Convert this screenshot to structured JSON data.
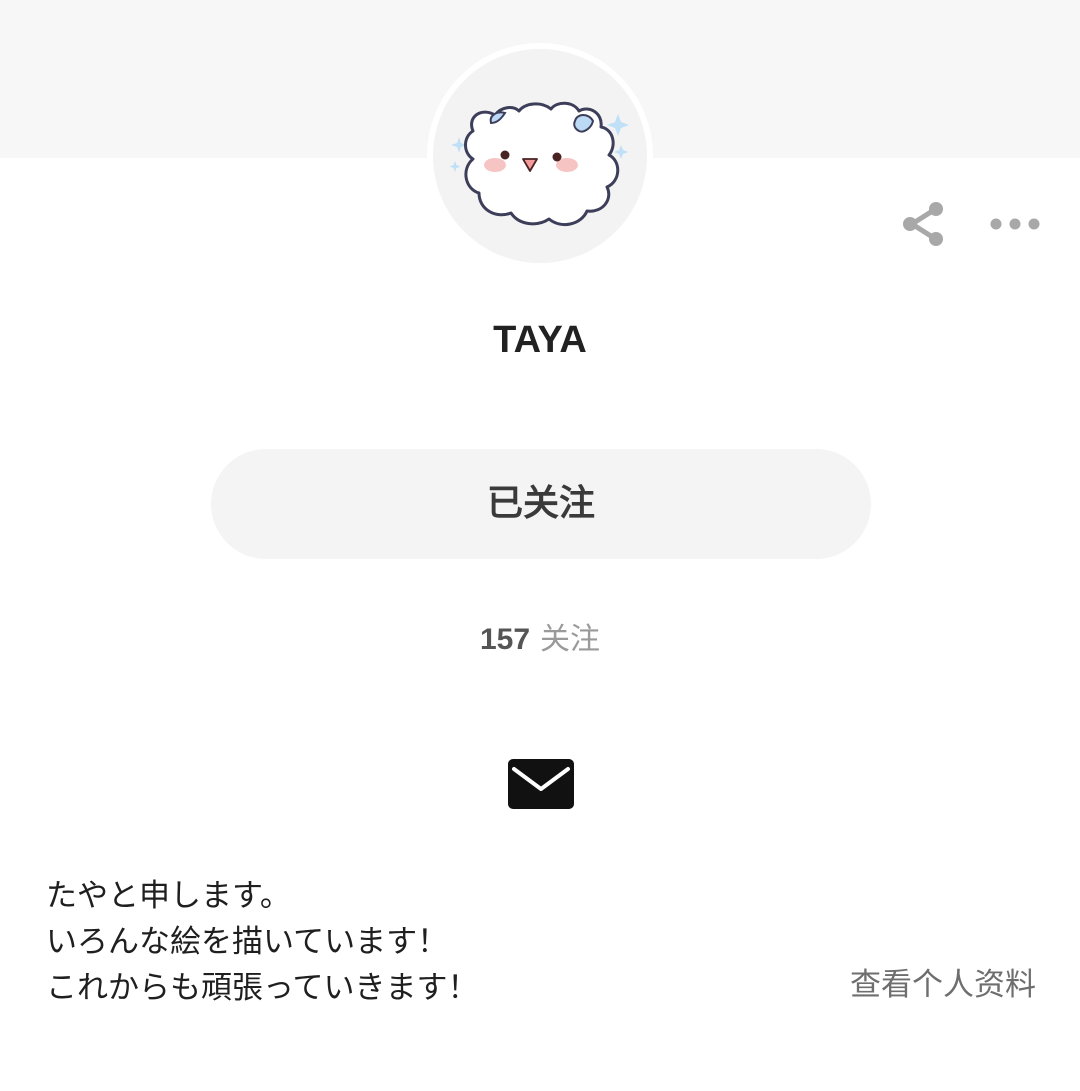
{
  "header": {
    "cover_color": "#f7f7f7"
  },
  "profile": {
    "avatar_icon": "cloud-bear-avatar",
    "username": "TAYA",
    "follow_button_label": "已关注",
    "following_count": "157",
    "following_label": "关注",
    "bio_lines": [
      "たやと申します。",
      "いろんな絵を描いています！",
      "これからも頑張っていきます！"
    ],
    "view_profile_label": "查看个人资料"
  },
  "actions": {
    "share_icon": "share-icon",
    "more_icon": "more-icon",
    "message_icon": "mail-icon"
  },
  "colors": {
    "icon_gray": "#a8a8a8",
    "follow_button_bg": "#f4f4f4",
    "text_primary": "#1f1f1f",
    "text_secondary": "#9a9a9a"
  }
}
